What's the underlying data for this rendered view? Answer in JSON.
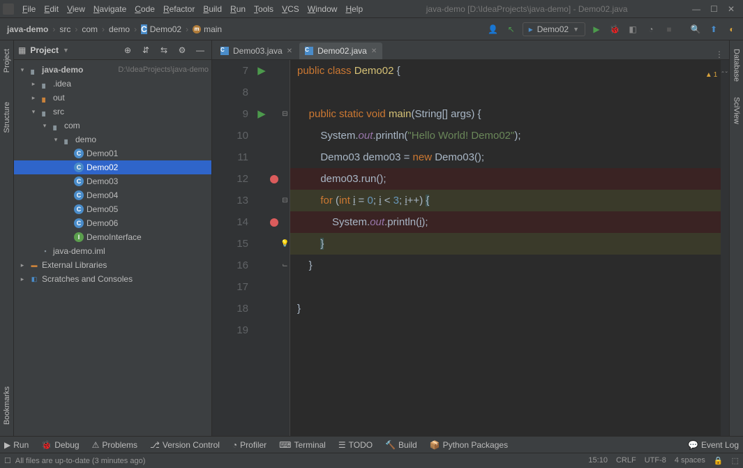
{
  "window": {
    "title": "java-demo [D:\\IdeaProjects\\java-demo] - Demo02.java",
    "menu": [
      "File",
      "Edit",
      "View",
      "Navigate",
      "Code",
      "Refactor",
      "Build",
      "Run",
      "Tools",
      "VCS",
      "Window",
      "Help"
    ]
  },
  "breadcrumb": {
    "items": [
      "java-demo",
      "src",
      "com",
      "demo",
      "Demo02",
      "main"
    ],
    "icons": [
      "",
      "",
      "",
      "",
      "class",
      "method"
    ]
  },
  "runconfig": {
    "label": "Demo02"
  },
  "project_panel": {
    "title": "Project",
    "tree": [
      {
        "depth": 0,
        "arrow": "v",
        "icon": "folder",
        "name": "java-demo",
        "path": "D:\\IdeaProjects\\java-demo",
        "bold": true
      },
      {
        "depth": 1,
        "arrow": ">",
        "icon": "folder",
        "name": ".idea"
      },
      {
        "depth": 1,
        "arrow": ">",
        "icon": "folder-o",
        "name": "out"
      },
      {
        "depth": 1,
        "arrow": "v",
        "icon": "folder",
        "name": "src"
      },
      {
        "depth": 2,
        "arrow": "v",
        "icon": "folder",
        "name": "com"
      },
      {
        "depth": 3,
        "arrow": "v",
        "icon": "folder",
        "name": "demo"
      },
      {
        "depth": 4,
        "arrow": "",
        "icon": "class",
        "name": "Demo01"
      },
      {
        "depth": 4,
        "arrow": "",
        "icon": "class",
        "name": "Demo02",
        "selected": true
      },
      {
        "depth": 4,
        "arrow": "",
        "icon": "class",
        "name": "Demo03"
      },
      {
        "depth": 4,
        "arrow": "",
        "icon": "class",
        "name": "Demo04"
      },
      {
        "depth": 4,
        "arrow": "",
        "icon": "class",
        "name": "Demo05"
      },
      {
        "depth": 4,
        "arrow": "",
        "icon": "class",
        "name": "Demo06"
      },
      {
        "depth": 4,
        "arrow": "",
        "icon": "iface",
        "name": "DemoInterface"
      },
      {
        "depth": 1,
        "arrow": "",
        "icon": "file",
        "name": "java-demo.iml"
      },
      {
        "depth": 0,
        "arrow": ">",
        "icon": "lib",
        "name": "External Libraries"
      },
      {
        "depth": 0,
        "arrow": ">",
        "icon": "scratch",
        "name": "Scratches and Consoles"
      }
    ]
  },
  "left_tabs": [
    "Project",
    "Structure",
    "Bookmarks"
  ],
  "right_tabs": [
    "Database",
    "SciView"
  ],
  "editor": {
    "tabs": [
      {
        "name": "Demo03.java",
        "active": false
      },
      {
        "name": "Demo02.java",
        "active": true
      }
    ],
    "warning_count": "1",
    "first_line_no": 7,
    "lines": [
      {
        "no": 7,
        "run": true,
        "fold": "",
        "bp": false,
        "html": "<span class='kw'>public</span> <span class='kw'>class</span> <span class='cls'>Demo02</span> {"
      },
      {
        "no": 8,
        "run": false,
        "fold": "",
        "bp": false,
        "html": ""
      },
      {
        "no": 9,
        "run": true,
        "fold": "open",
        "bp": false,
        "html": "    <span class='kw'>public</span> <span class='kw'>static</span> <span class='kw'>void</span> <span class='cls'>main</span>(String[] args) {"
      },
      {
        "no": 10,
        "run": false,
        "fold": "",
        "bp": false,
        "html": "        System.<span class='field'>out</span>.println(<span class='str'>\"Hello World! Demo02\"</span>);"
      },
      {
        "no": 11,
        "run": false,
        "fold": "",
        "bp": false,
        "html": "        Demo03 demo03 = <span class='kw'>new</span> Demo03();"
      },
      {
        "no": 12,
        "run": false,
        "fold": "",
        "bp": true,
        "cls": "bp-line",
        "html": "        demo03.run();"
      },
      {
        "no": 13,
        "run": false,
        "fold": "open",
        "bp": false,
        "cls": "for-line",
        "html": "        <span class='kw'>for</span> (<span class='kw'>int</span> <span style='text-decoration:underline'>i</span> = <span class='num'>0</span>; <span style='text-decoration:underline'>i</span> &lt; <span class='num'>3</span>; <span style='text-decoration:underline'>i</span>++) <span class='caret-brace'>{</span>"
      },
      {
        "no": 14,
        "run": false,
        "fold": "",
        "bp": true,
        "cls": "bp-line",
        "html": "            System.<span class='field'>out</span>.println(<span style='text-decoration:underline'>i</span>);"
      },
      {
        "no": 15,
        "run": false,
        "fold": "close",
        "bp": false,
        "bulb": true,
        "cls": "for-line",
        "html": "        <span class='caret-brace'>}</span>"
      },
      {
        "no": 16,
        "run": false,
        "fold": "close",
        "bp": false,
        "html": "    }"
      },
      {
        "no": 17,
        "run": false,
        "fold": "",
        "bp": false,
        "html": ""
      },
      {
        "no": 18,
        "run": false,
        "fold": "",
        "bp": false,
        "html": "}"
      },
      {
        "no": 19,
        "run": false,
        "fold": "",
        "bp": false,
        "html": ""
      }
    ]
  },
  "toolwindows": [
    "Run",
    "Debug",
    "Problems",
    "Version Control",
    "Profiler",
    "Terminal",
    "TODO",
    "Build",
    "Python Packages"
  ],
  "toolwindows_right": "Event Log",
  "statusbar": {
    "left": "All files are up-to-date (3 minutes ago)",
    "caret": "15:10",
    "eol": "CRLF",
    "encoding": "UTF-8",
    "indent": "4 spaces"
  }
}
